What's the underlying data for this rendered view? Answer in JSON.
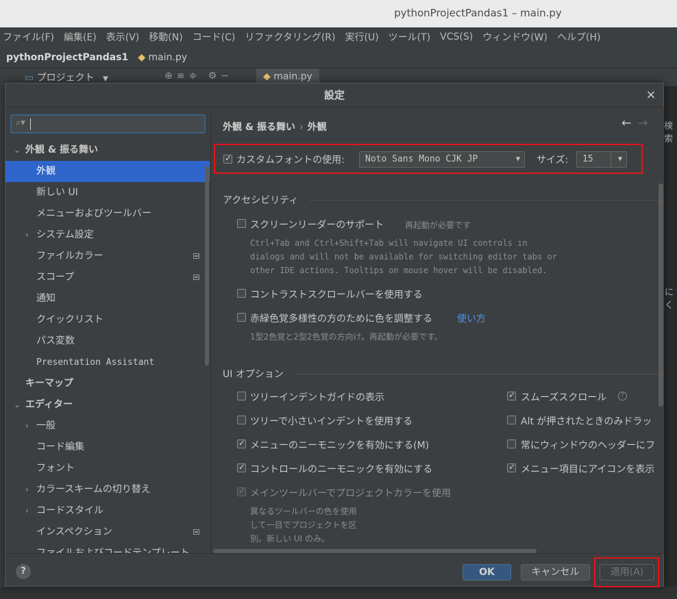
{
  "window": {
    "title": "pythonProjectPandas1 – main.py"
  },
  "menu": [
    "ファイル(F)",
    "編集(E)",
    "表示(V)",
    "移動(N)",
    "コード(C)",
    "リファクタリング(R)",
    "実行(U)",
    "ツール(T)",
    "VCS(S)",
    "ウィンドウ(W)",
    "ヘルプ(H)"
  ],
  "nav": {
    "project": "pythonProjectPandas1",
    "file": "main.py"
  },
  "toolwindow": {
    "project_label": "プロジェクト",
    "tab": "main.py"
  },
  "edge": {
    "search_fragment": "検索",
    "side_fragment": "にく"
  },
  "dialog": {
    "title": "設定",
    "close": "×",
    "search": {
      "placeholder": ""
    },
    "tree": [
      {
        "label": "外観 & 振る舞い",
        "level": 0,
        "expanded": true,
        "bold": true
      },
      {
        "label": "外観",
        "level": 1,
        "selected": true
      },
      {
        "label": "新しい UI",
        "level": 1
      },
      {
        "label": "メニューおよびツールバー",
        "level": 1
      },
      {
        "label": "システム設定",
        "level": 1,
        "collapsed": true
      },
      {
        "label": "ファイルカラー",
        "level": 1,
        "marker": true
      },
      {
        "label": "スコープ",
        "level": 1,
        "marker": true
      },
      {
        "label": "通知",
        "level": 1
      },
      {
        "label": "クイックリスト",
        "level": 1
      },
      {
        "label": "パス変数",
        "level": 1
      },
      {
        "label": "Presentation Assistant",
        "level": 1
      },
      {
        "label": "キーマップ",
        "level": 0,
        "bold": true
      },
      {
        "label": "エディター",
        "level": 0,
        "expanded": true,
        "bold": true
      },
      {
        "label": "一般",
        "level": 1,
        "collapsed": true
      },
      {
        "label": "コード編集",
        "level": 1
      },
      {
        "label": "フォント",
        "level": 1
      },
      {
        "label": "カラースキームの切り替え",
        "level": 1,
        "collapsed": true
      },
      {
        "label": "コードスタイル",
        "level": 1,
        "collapsed": true
      },
      {
        "label": "インスペクション",
        "level": 1,
        "marker": true
      },
      {
        "label": "ファイルおよびコードテンプレート",
        "level": 1
      }
    ],
    "breadcrumb": {
      "parent": "外観 & 振る舞い",
      "sep": "›",
      "current": "外観"
    },
    "back": "←",
    "forward": "→",
    "font": {
      "checkbox_label": "カスタムフォントの使用:",
      "checked": true,
      "family": "Noto Sans Mono CJK JP",
      "size_label": "サイズ:",
      "size": "15"
    },
    "accessibility": {
      "heading": "アクセシビリティ",
      "screen_reader": "スクリーンリーダーのサポート",
      "restart": "再起動が必要です",
      "screen_reader_help": [
        "Ctrl+Tab and Ctrl+Shift+Tab will navigate UI controls in",
        "dialogs and will not be available for switching editor tabs or",
        "other IDE actions. Tooltips on mouse hover will be disabled."
      ],
      "contrast_scrollbars": "コントラストスクロールバーを使用する",
      "color_deficiency": "赤緑色覚多様性の方のために色を調整する",
      "how_it_works": "使い方",
      "color_deficiency_help": "1型2色覚と2型2色覚の方向け。再起動が必要です。"
    },
    "ui_options": {
      "heading": "UI オプション",
      "left": [
        {
          "label": "ツリーインデントガイドの表示",
          "checked": false
        },
        {
          "label": "ツリーで小さいインデントを使用する",
          "checked": false
        },
        {
          "label": "メニューのニーモニックを有効にする(M)",
          "checked": true
        },
        {
          "label": "コントロールのニーモニックを有効にする",
          "checked": true
        },
        {
          "label": "メインツールバーでプロジェクトカラーを使用",
          "checked": true,
          "disabled": true
        }
      ],
      "right": [
        {
          "label": "スムーズスクロール",
          "checked": true,
          "help": "?"
        },
        {
          "label": "Alt が押されたときのみドラッ",
          "checked": false
        },
        {
          "label": "常にウィンドウのヘッダーにフ",
          "checked": false
        },
        {
          "label": "メニュー項目にアイコンを表示",
          "checked": true
        }
      ],
      "project_color_help": [
        "異なるツールバーの色を使用",
        "して一目でプロジェクトを区",
        "別。新しい UI のみ。"
      ]
    },
    "buttons": {
      "help": "?",
      "ok": "OK",
      "cancel": "キャンセル",
      "apply": "適用(A)"
    }
  },
  "colors": {
    "selection": "#2f65ca",
    "link": "#5394ec",
    "highlight_box": "#e3131b",
    "ok_button": "#365880"
  }
}
